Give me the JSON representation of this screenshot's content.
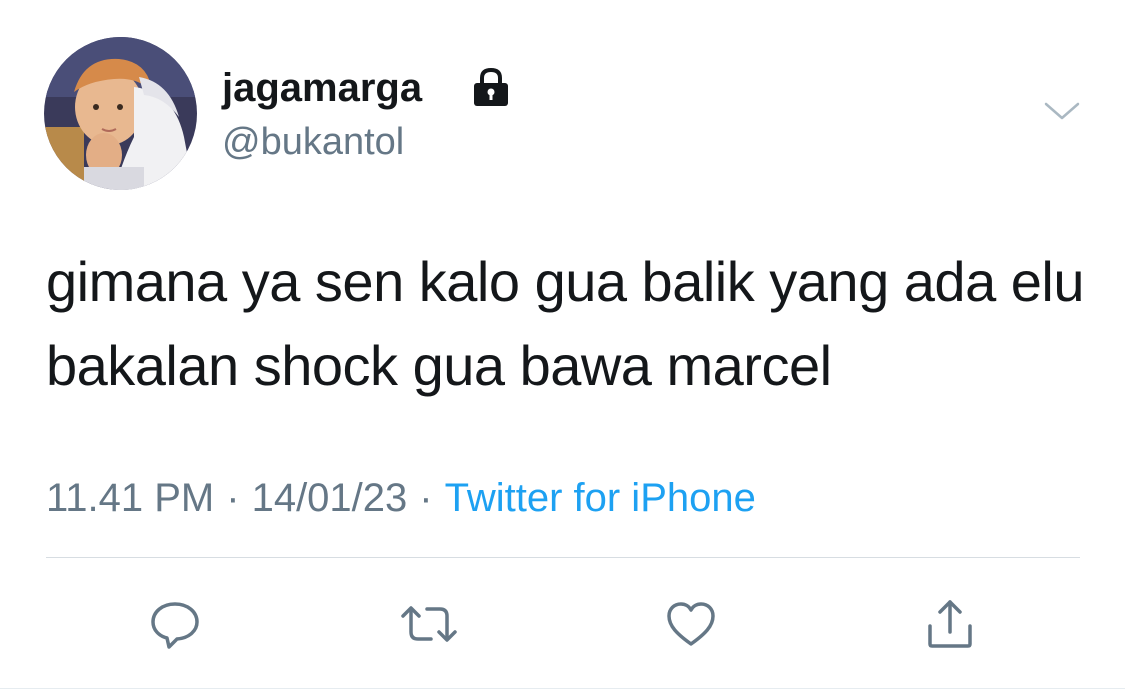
{
  "user": {
    "display_name": "jagamarga",
    "handle": "@bukantol",
    "protected": true
  },
  "tweet": {
    "text": "gimana ya sen kalo gua balik yang ada elu bakalan shock gua bawa marcel",
    "time": "11.41 PM",
    "date": "14/01/23",
    "separator": "·",
    "source": "Twitter for iPhone"
  },
  "actions": {
    "reply_icon": "reply-icon",
    "retweet_icon": "retweet-icon",
    "like_icon": "heart-icon",
    "share_icon": "share-icon"
  },
  "colors": {
    "text": "#14171a",
    "secondary": "#657786",
    "link": "#1da1f2",
    "divider": "#d7dde2"
  }
}
